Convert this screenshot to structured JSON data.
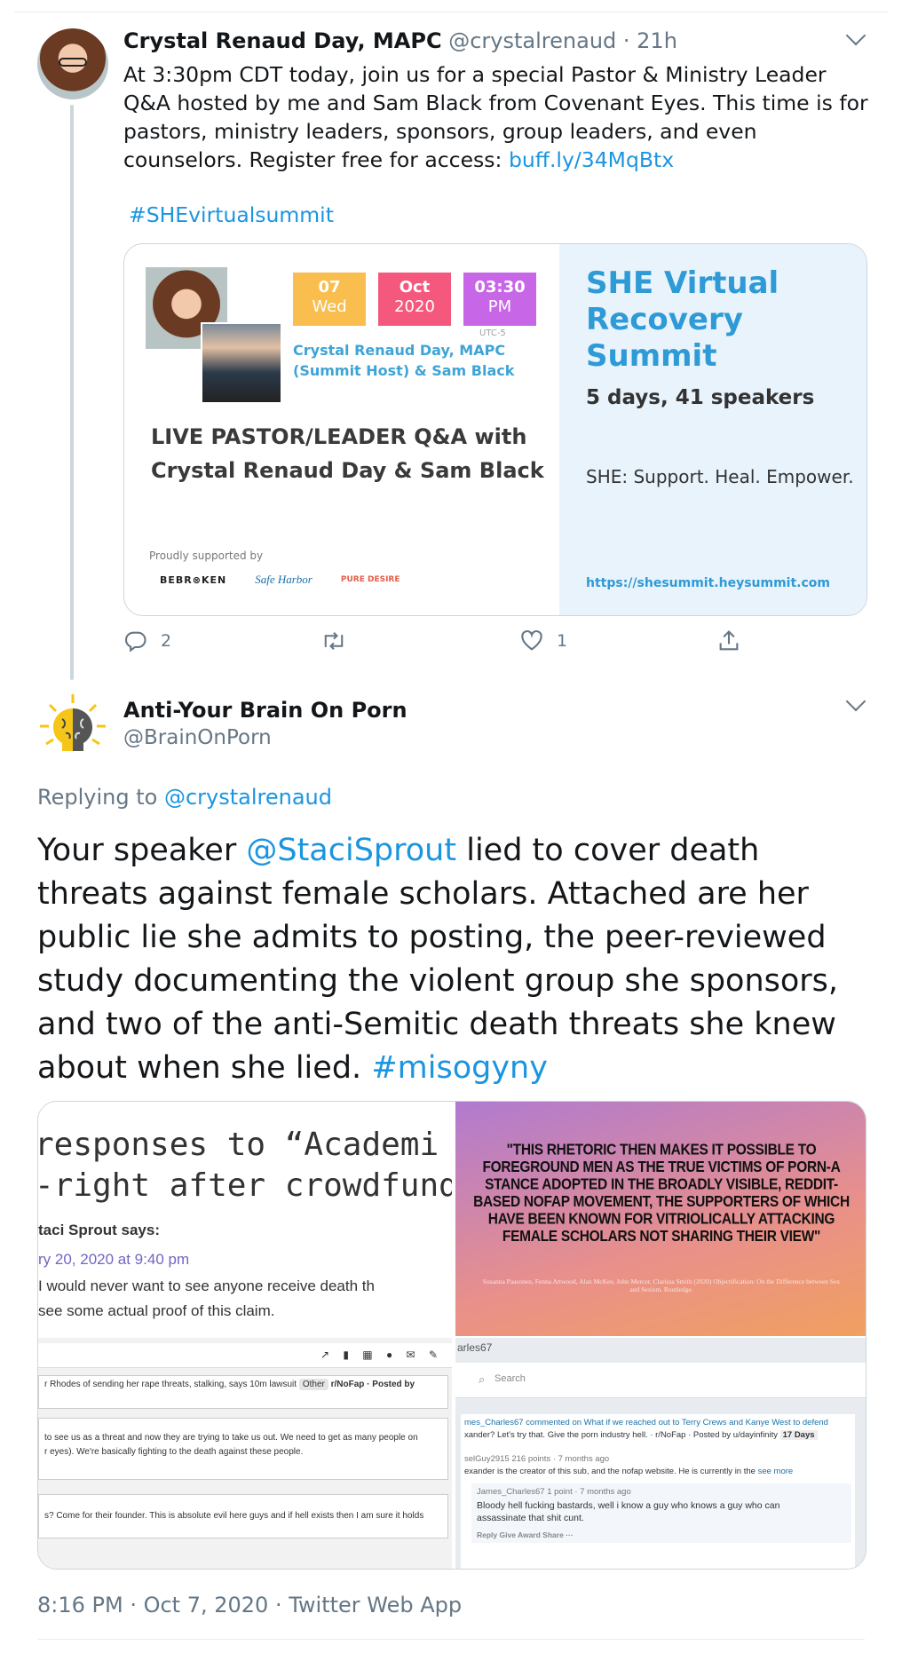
{
  "tweet1": {
    "name": "Crystal Renaud Day, MAPC",
    "handle": "@crystalrenaud",
    "time": "· 21h",
    "text": "At 3:30pm CDT today, join us for a special Pastor & Ministry Leader Q&A hosted by me and Sam Black from Covenant Eyes. This time is for pastors, ministry leaders, sponsors, group leaders, and even counselors. Register free for access:",
    "link": "buff.ly/34MqBtx",
    "hashtag": "#SHEvirtualsummit",
    "card": {
      "date_day": "07",
      "date_weekday": "Wed",
      "date_month": "Oct",
      "date_year": "2020",
      "date_time": "03:30",
      "date_ampm": "PM",
      "utc": "UTC-5",
      "hosts": "Crystal Renaud Day, MAPC (Summit Host) & Sam Black",
      "live_title": "LIVE PASTOR/LEADER Q&A with Crystal Renaud Day & Sam Black",
      "proudly": "Proudly supported by",
      "logo1": "BEBR⊗KEN",
      "logo2": "Safe Harbor",
      "logo3": "PURE DESIRE",
      "summit_title": "SHE Virtual Recovery Summit",
      "summit_sub": "5 days, 41 speakers",
      "summit_tag": "SHE: Support. Heal. Empower.",
      "summit_url": "https://shesummit.heysummit.com",
      "colors": {
        "day": "#f9be4e",
        "month": "#f4587d",
        "time": "#c866e8"
      }
    },
    "actions": {
      "reply_count": "2",
      "retweet_count": "",
      "like_count": "1"
    }
  },
  "tweet2": {
    "name": "Anti-Your Brain On Porn",
    "handle": "@BrainOnPorn",
    "replying_label": "Replying to",
    "replying_to": "@crystalrenaud",
    "text_pre": "Your speaker",
    "mention": "@StaciSprout",
    "text_post": "lied to cover death threats against female scholars. Attached are her public lie she admits to posting, the peer-reviewed study documenting the violent group she sponsors, and two of the anti-Semitic death threats she knew about when she lied.",
    "hashtag": "#misogyny",
    "media": {
      "m1_line1": "responses to “Academi",
      "m1_line2": "-right after crowdfunding",
      "m1_author": "taci Sprout says:",
      "m1_date": "ry 20, 2020 at 9:40 pm",
      "m1_text1": "I would never want to see anyone receive death th",
      "m1_text2": "see some actual proof of this claim.",
      "m2_quote": "\"THIS RHETORIC THEN MAKES IT POSSIBLE TO FOREGROUND MEN AS THE TRUE VICTIMS OF PORN-A STANCE ADOPTED IN THE BROADLY VISIBLE, REDDIT-BASED NOFAP MOVEMENT, THE SUPPORTERS OF WHICH HAVE BEEN KNOWN FOR VITRIOLICALLY ATTACKING FEMALE SCHOLARS NOT SHARING THEIR VIEW\"",
      "m2_cite": "Susanna Paasonen, Fenna Attwood, Alan McKee, John Mercer, Clarissa Smith (2020) Objectification: On the Difference between Sex and Sexism. Routledge.",
      "m3_post1": "r Rhodes of sending her rape threats, stalking, says 10m lawsuit",
      "m3_tag": "Other",
      "m3_sub": "r/NoFap · Posted by",
      "m3_post2a": "to see us as a threat and now they are trying to take us out. We need to get as many people on",
      "m3_post2b": "r eyes). We're basically fighting to the death against these people.",
      "m3_post3": "s? Come for their founder. This is absolute evil here guys and if hell exists then I am sure it holds",
      "m4_user": "arles67",
      "m4_search": "Search",
      "m4_c1": "mes_Charles67 commented on What if we reached out to Terry Crews and Kanye West to defend",
      "m4_c1b": "xander? Let's try that. Give the porn industry hell. · r/NoFap · Posted by u/dayinfinity",
      "m4_days": "17 Days",
      "m4_c2": "selGuy2915  216 points · 7 months ago",
      "m4_c2b": "exander is the creator of this sub, and the nofap website. He is currently in the",
      "m4_seemore": "see more",
      "m4_c3": "James_Charles67  1 point · 7 months ago",
      "m4_c3b": "Bloody hell fucking bastards, well i know a guy who knows a guy who can",
      "m4_c3c": "assassinate that shit cunt.",
      "m4_c3d": "Reply   Give Award   Share   ···"
    },
    "footer": "8:16 PM · Oct 7, 2020 · Twitter Web App"
  }
}
